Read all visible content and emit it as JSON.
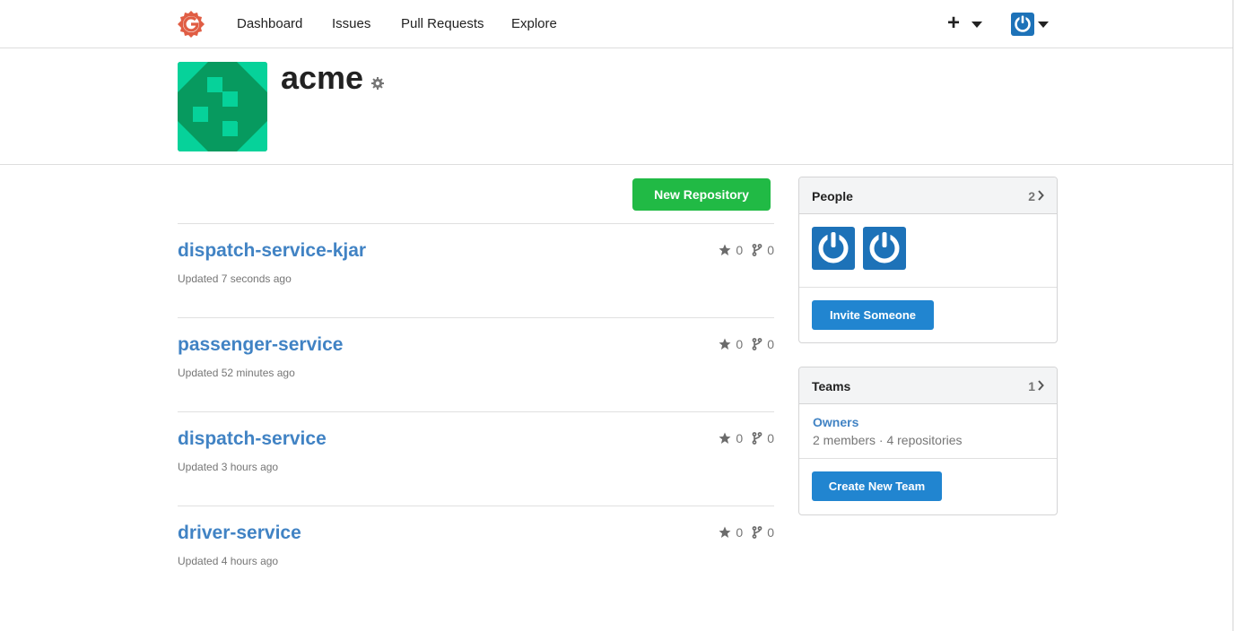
{
  "nav": {
    "items": [
      {
        "label": "Dashboard"
      },
      {
        "label": "Issues"
      },
      {
        "label": "Pull Requests"
      },
      {
        "label": "Explore"
      }
    ],
    "create_icon": "plus-icon",
    "user_icon": "power-icon"
  },
  "org": {
    "name": "acme",
    "settings_icon": "gear-icon"
  },
  "actions": {
    "new_repo_label": "New Repository"
  },
  "repos": [
    {
      "name": "dispatch-service-kjar",
      "updated": "Updated 7 seconds ago",
      "stars": "0",
      "forks": "0"
    },
    {
      "name": "passenger-service",
      "updated": "Updated 52 minutes ago",
      "stars": "0",
      "forks": "0"
    },
    {
      "name": "dispatch-service",
      "updated": "Updated 3 hours ago",
      "stars": "0",
      "forks": "0"
    },
    {
      "name": "driver-service",
      "updated": "Updated 4 hours ago",
      "stars": "0",
      "forks": "0"
    }
  ],
  "people": {
    "title": "People",
    "count": "2",
    "invite_label": "Invite Someone"
  },
  "teams": {
    "title": "Teams",
    "count": "1",
    "items": [
      {
        "name": "Owners",
        "meta": "2 members · 4 repositories"
      }
    ],
    "create_label": "Create New Team"
  },
  "colors": {
    "accent_green": "#21ba45",
    "accent_blue": "#2185d0",
    "link": "#4183c4",
    "logo": "#e05d44",
    "org_avatar_dark": "#079a5f",
    "org_avatar_light": "#06d29a"
  }
}
